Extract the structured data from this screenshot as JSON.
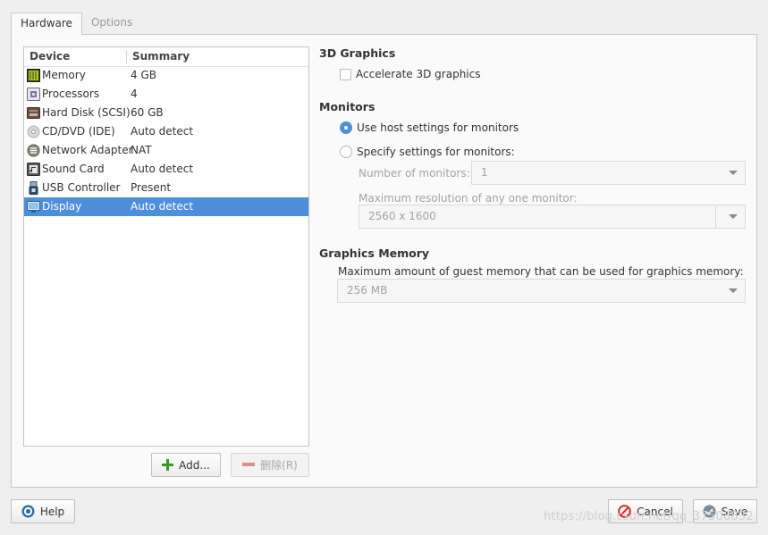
{
  "tabs": [
    {
      "label": "Hardware",
      "active": true
    },
    {
      "label": "Options",
      "active": false
    }
  ],
  "device_list": {
    "headers": {
      "device": "Device",
      "summary": "Summary"
    },
    "rows": [
      {
        "icon": "memory-icon",
        "device": "Memory",
        "summary": "4 GB",
        "selected": false
      },
      {
        "icon": "processor-icon",
        "device": "Processors",
        "summary": "4",
        "selected": false
      },
      {
        "icon": "hard-disk-icon",
        "device": "Hard Disk (SCSI)",
        "summary": "60 GB",
        "selected": false
      },
      {
        "icon": "cd-dvd-icon",
        "device": "CD/DVD (IDE)",
        "summary": "Auto detect",
        "selected": false
      },
      {
        "icon": "network-adapter-icon",
        "device": "Network Adapter",
        "summary": "NAT",
        "selected": false
      },
      {
        "icon": "sound-card-icon",
        "device": "Sound Card",
        "summary": "Auto detect",
        "selected": false
      },
      {
        "icon": "usb-controller-icon",
        "device": "USB Controller",
        "summary": "Present",
        "selected": false
      },
      {
        "icon": "display-icon",
        "device": "Display",
        "summary": "Auto detect",
        "selected": true
      }
    ]
  },
  "list_buttons": {
    "add": "Add...",
    "remove": "删除(R)"
  },
  "graphics_3d": {
    "title": "3D Graphics",
    "accelerate_label": "Accelerate 3D graphics",
    "accelerate_checked": false
  },
  "monitors": {
    "title": "Monitors",
    "use_host_label": "Use host settings for monitors",
    "specify_label": "Specify settings for monitors:",
    "selected": "use_host",
    "num_monitors_label": "Number of monitors:",
    "num_monitors_value": "1",
    "max_res_label": "Maximum resolution of any one monitor:",
    "max_res_value": "2560 x 1600"
  },
  "graphics_memory": {
    "title": "Graphics Memory",
    "desc": "Maximum amount of guest memory that can be used for graphics memory:",
    "value": "256 MB"
  },
  "footer": {
    "help": "Help",
    "cancel": "Cancel",
    "save": "Save"
  },
  "watermark": "https://blog.csdn.net/qq_37508832",
  "colors": {
    "selection": "#4e8fdc",
    "cancel_icon": "#d6262b",
    "add_icon": "#3a9a1e",
    "remove_icon": "#e06a6a",
    "help_icon": "#2f6fa8"
  }
}
